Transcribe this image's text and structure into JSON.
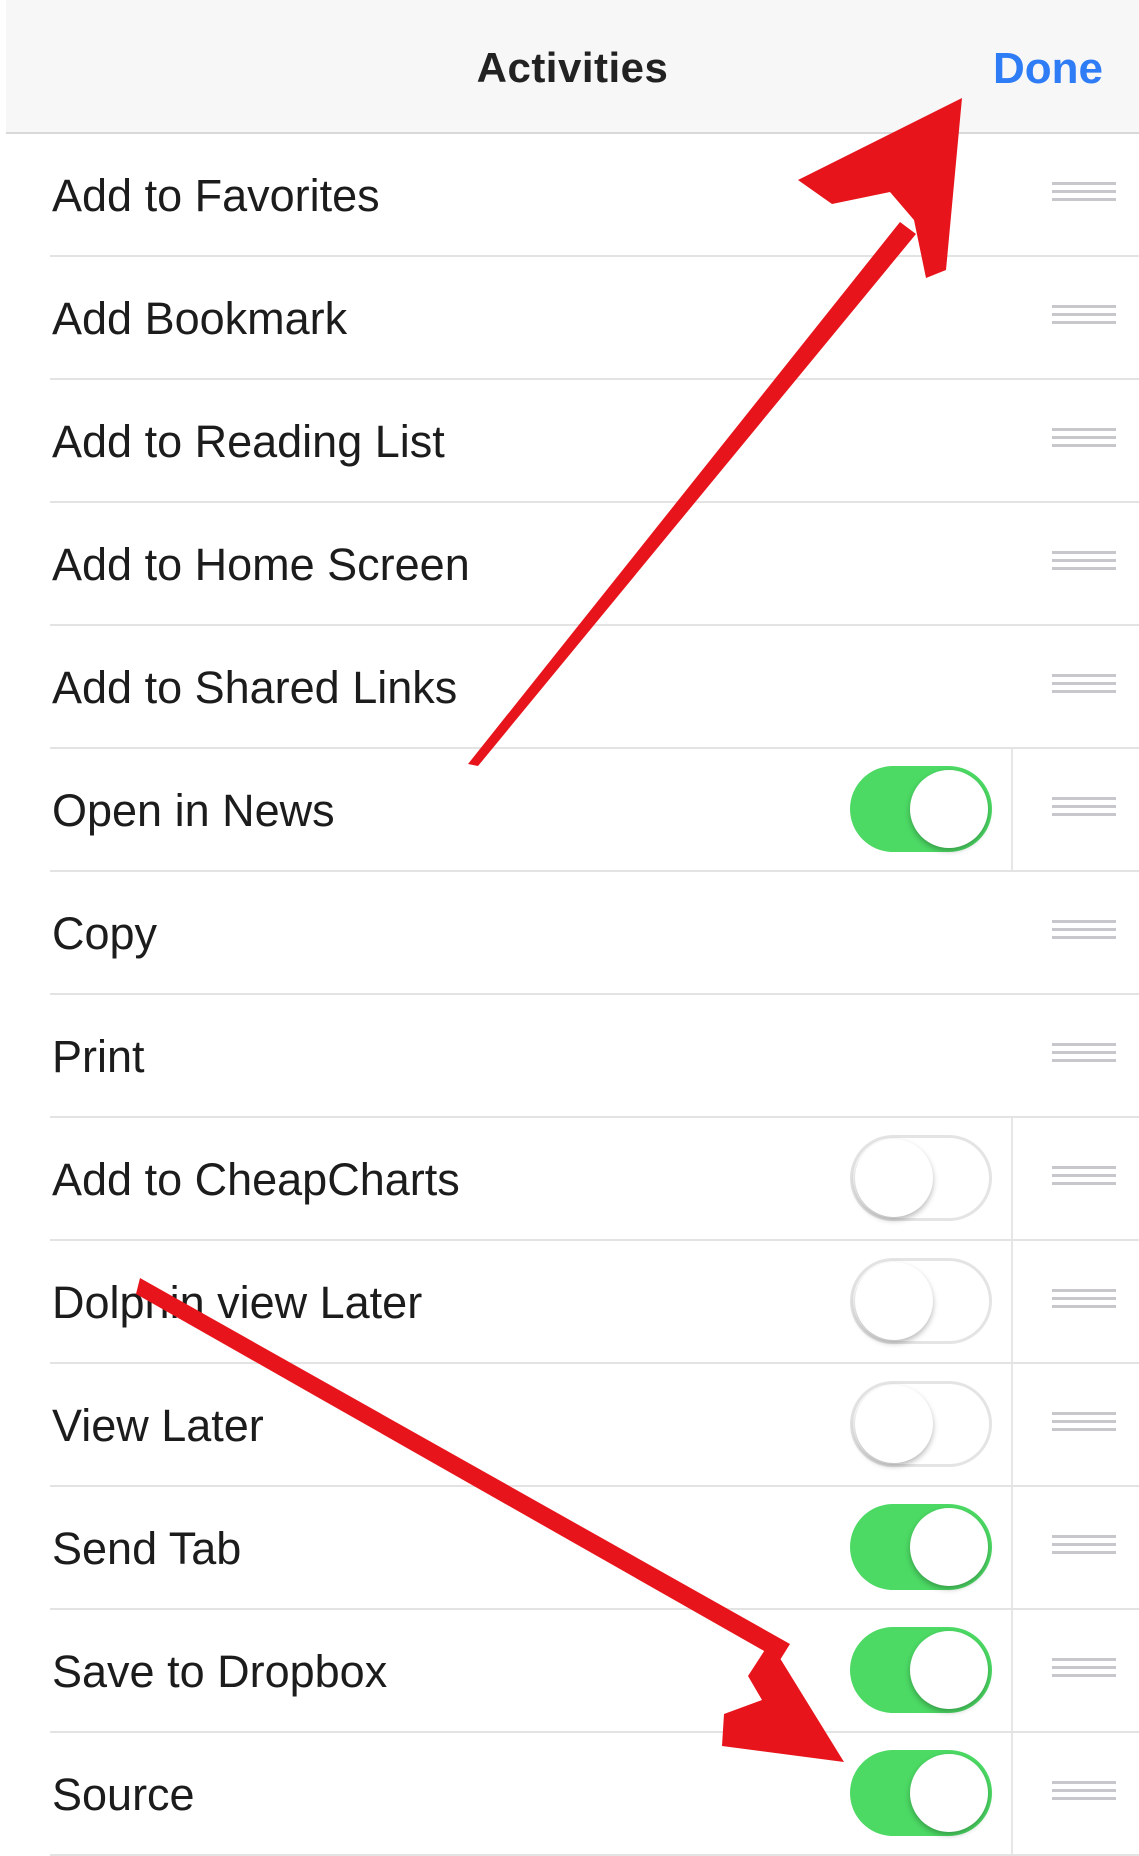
{
  "nav": {
    "title": "Activities",
    "done_label": "Done"
  },
  "accent_color": "#2e7cf6",
  "toggle_on_color": "#4cd964",
  "annotation_color": "#e8141b",
  "activities": [
    {
      "label": "Add to Favorites",
      "toggle": null
    },
    {
      "label": "Add Bookmark",
      "toggle": null
    },
    {
      "label": "Add to Reading List",
      "toggle": null
    },
    {
      "label": "Add to Home Screen",
      "toggle": null
    },
    {
      "label": "Add to Shared Links",
      "toggle": null
    },
    {
      "label": "Open in News",
      "toggle": "on"
    },
    {
      "label": "Copy",
      "toggle": null
    },
    {
      "label": "Print",
      "toggle": null
    },
    {
      "label": "Add to CheapCharts",
      "toggle": "off"
    },
    {
      "label": "Dolphin view Later",
      "toggle": "off"
    },
    {
      "label": "View Later",
      "toggle": "off"
    },
    {
      "label": "Send Tab",
      "toggle": "on"
    },
    {
      "label": "Save to Dropbox",
      "toggle": "on"
    },
    {
      "label": "Source",
      "toggle": "on"
    }
  ]
}
